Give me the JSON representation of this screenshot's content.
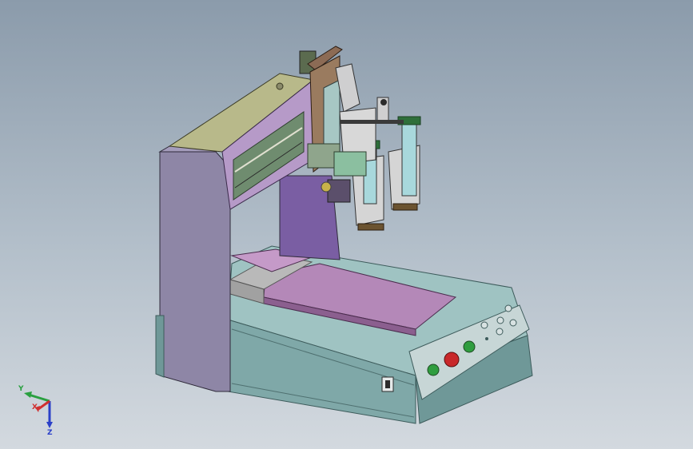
{
  "colors": {
    "base_teal": "#7fa8a8",
    "frame_purple": "#8e86a6",
    "olive_top": "#b8b98a",
    "bed_magenta": "#b488b8",
    "plate_grey": "#b9b9b9",
    "syringe_cyan": "#a8d8dc",
    "green_button": "#2f9d3f",
    "red_button": "#c8282a",
    "axis_x": "#d03030",
    "axis_y": "#2aa040",
    "axis_z": "#2b40c8"
  },
  "icons": {
    "triad": "coordinate-triad-icon",
    "power_switch": "rocker-switch-icon"
  },
  "triad": {
    "x_label": "X",
    "y_label": "Y",
    "z_label": "Z"
  }
}
